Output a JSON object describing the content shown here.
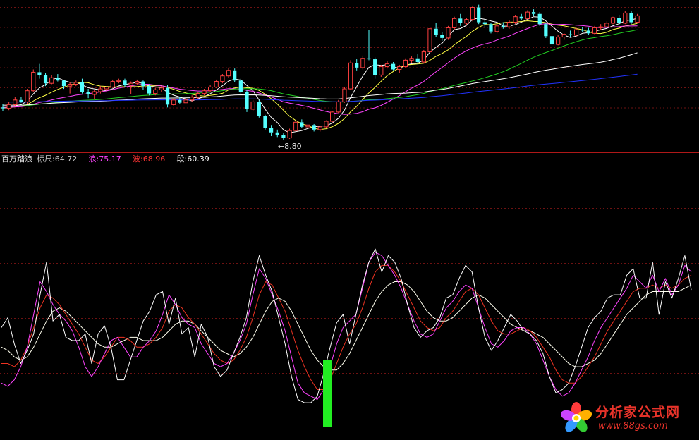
{
  "chart_data": [
    {
      "type": "candlestick",
      "panel": "price",
      "grid": true,
      "min_price_label": "←8.80",
      "ylim": [
        8.2,
        16.2
      ],
      "candles": [
        [
          10.55,
          10.75,
          10.35,
          10.5
        ],
        [
          10.5,
          10.85,
          10.4,
          10.7
        ],
        [
          10.7,
          11.1,
          10.6,
          10.95
        ],
        [
          10.95,
          11.1,
          10.8,
          10.85
        ],
        [
          10.85,
          11.55,
          10.75,
          11.45
        ],
        [
          11.45,
          12.6,
          11.4,
          12.45
        ],
        [
          12.45,
          12.9,
          12.1,
          12.3
        ],
        [
          12.3,
          12.4,
          11.7,
          11.85
        ],
        [
          11.85,
          12.3,
          11.8,
          12.15
        ],
        [
          12.15,
          12.35,
          11.95,
          12.0
        ],
        [
          12.0,
          12.05,
          11.55,
          11.7
        ],
        [
          11.7,
          11.9,
          11.3,
          11.8
        ],
        [
          11.8,
          12.0,
          11.7,
          11.9
        ],
        [
          11.9,
          12.1,
          11.3,
          11.4
        ],
        [
          11.4,
          11.55,
          11.05,
          11.25
        ],
        [
          11.25,
          11.5,
          11.0,
          11.4
        ],
        [
          11.4,
          11.7,
          11.3,
          11.55
        ],
        [
          11.55,
          11.7,
          11.45,
          11.65
        ],
        [
          11.65,
          12.05,
          11.6,
          11.95
        ],
        [
          11.95,
          12.1,
          11.85,
          12.0
        ],
        [
          12.0,
          12.1,
          11.65,
          11.75
        ],
        [
          11.75,
          11.95,
          11.25,
          11.85
        ],
        [
          11.85,
          12.05,
          11.75,
          11.95
        ],
        [
          11.95,
          12.0,
          11.5,
          11.7
        ],
        [
          11.7,
          11.8,
          11.2,
          11.3
        ],
        [
          11.3,
          11.6,
          11.2,
          11.5
        ],
        [
          11.5,
          11.7,
          11.4,
          11.6
        ],
        [
          11.6,
          11.75,
          10.55,
          10.7
        ],
        [
          10.7,
          11.05,
          10.6,
          10.95
        ],
        [
          10.95,
          11.1,
          10.75,
          10.8
        ],
        [
          10.8,
          11.0,
          10.65,
          10.95
        ],
        [
          10.95,
          11.2,
          10.85,
          11.1
        ],
        [
          11.1,
          11.4,
          11.0,
          11.3
        ],
        [
          11.3,
          11.55,
          11.2,
          11.45
        ],
        [
          11.45,
          11.75,
          11.4,
          11.65
        ],
        [
          11.65,
          12.05,
          11.6,
          11.95
        ],
        [
          11.95,
          12.35,
          11.85,
          12.25
        ],
        [
          12.25,
          12.7,
          12.15,
          12.55
        ],
        [
          12.55,
          12.65,
          11.9,
          12.0
        ],
        [
          12.0,
          12.1,
          11.3,
          11.4
        ],
        [
          11.4,
          11.5,
          10.3,
          10.45
        ],
        [
          10.45,
          10.95,
          10.35,
          10.85
        ],
        [
          10.85,
          10.95,
          10.0,
          10.1
        ],
        [
          10.1,
          10.15,
          9.35,
          9.45
        ],
        [
          9.45,
          9.6,
          9.0,
          9.2
        ],
        [
          9.2,
          9.35,
          8.95,
          9.05
        ],
        [
          9.05,
          9.15,
          8.8,
          8.9
        ],
        [
          8.9,
          9.4,
          8.85,
          9.3
        ],
        [
          9.3,
          9.8,
          9.25,
          9.75
        ],
        [
          9.75,
          9.9,
          9.45,
          9.5
        ],
        [
          9.5,
          9.7,
          9.3,
          9.6
        ],
        [
          9.6,
          9.65,
          9.25,
          9.35
        ],
        [
          9.35,
          9.55,
          9.25,
          9.5
        ],
        [
          9.5,
          9.85,
          9.45,
          9.8
        ],
        [
          9.8,
          10.35,
          9.75,
          10.3
        ],
        [
          10.3,
          10.95,
          10.25,
          10.85
        ],
        [
          10.85,
          11.65,
          10.8,
          11.55
        ],
        [
          11.55,
          13.1,
          11.5,
          12.95
        ],
        [
          12.95,
          13.15,
          12.55,
          12.7
        ],
        [
          12.7,
          13.35,
          12.6,
          13.2
        ],
        [
          13.2,
          14.75,
          13.1,
          13.15
        ],
        [
          13.15,
          13.25,
          12.1,
          12.3
        ],
        [
          12.3,
          12.85,
          12.2,
          12.75
        ],
        [
          12.75,
          13.05,
          12.65,
          12.9
        ],
        [
          12.9,
          13.0,
          12.55,
          12.6
        ],
        [
          12.6,
          12.85,
          12.4,
          12.75
        ],
        [
          12.75,
          13.2,
          12.7,
          13.1
        ],
        [
          13.1,
          13.3,
          12.95,
          13.2
        ],
        [
          13.2,
          13.45,
          12.9,
          13.0
        ],
        [
          13.0,
          13.65,
          12.95,
          13.55
        ],
        [
          13.55,
          14.95,
          13.45,
          14.8
        ],
        [
          14.8,
          15.1,
          14.35,
          14.45
        ],
        [
          14.45,
          14.6,
          14.15,
          14.3
        ],
        [
          14.3,
          14.95,
          14.2,
          14.85
        ],
        [
          14.85,
          15.45,
          14.75,
          15.35
        ],
        [
          15.35,
          15.6,
          14.95,
          15.1
        ],
        [
          15.1,
          15.4,
          15.0,
          15.3
        ],
        [
          15.3,
          16.05,
          15.2,
          15.95
        ],
        [
          15.95,
          16.1,
          15.05,
          15.15
        ],
        [
          15.15,
          15.3,
          14.85,
          15.05
        ],
        [
          15.05,
          15.1,
          14.55,
          14.65
        ],
        [
          14.65,
          15.05,
          14.55,
          14.95
        ],
        [
          14.95,
          15.15,
          14.8,
          14.9
        ],
        [
          14.9,
          15.25,
          14.8,
          15.15
        ],
        [
          15.15,
          15.55,
          15.05,
          15.45
        ],
        [
          15.45,
          15.6,
          15.25,
          15.35
        ],
        [
          15.35,
          15.8,
          15.3,
          15.7
        ],
        [
          15.7,
          15.85,
          15.5,
          15.6
        ],
        [
          15.6,
          15.7,
          14.95,
          15.05
        ],
        [
          15.05,
          15.1,
          14.3,
          14.4
        ],
        [
          14.4,
          14.45,
          13.85,
          13.95
        ],
        [
          13.95,
          14.45,
          13.9,
          14.35
        ],
        [
          14.35,
          14.55,
          14.2,
          14.5
        ],
        [
          14.5,
          14.7,
          14.35,
          14.45
        ],
        [
          14.45,
          14.85,
          14.4,
          14.75
        ],
        [
          14.75,
          14.9,
          14.6,
          14.7
        ],
        [
          14.7,
          14.85,
          14.45,
          14.55
        ],
        [
          14.55,
          14.95,
          14.5,
          14.85
        ],
        [
          14.85,
          15.05,
          14.75,
          14.9
        ],
        [
          14.9,
          15.2,
          14.85,
          15.1
        ],
        [
          15.1,
          15.45,
          15.05,
          15.4
        ],
        [
          15.4,
          15.55,
          15.0,
          15.1
        ],
        [
          15.1,
          15.75,
          15.05,
          15.65
        ],
        [
          15.65,
          15.75,
          15.05,
          15.15
        ],
        [
          15.15,
          15.6,
          15.1,
          15.5
        ]
      ],
      "lines": [
        {
          "color": "#ffffff",
          "kind": "ma",
          "period": 5
        },
        {
          "color": "#ffff44",
          "kind": "ma",
          "period": 10
        },
        {
          "color": "#ff44ff",
          "kind": "ma",
          "period": 20
        },
        {
          "color": "#22cc22",
          "kind": "ma",
          "period": 40
        },
        {
          "color": "#ffffff",
          "kind": "ma",
          "period": 60
        },
        {
          "color": "#2233ff",
          "kind": "ma",
          "period": 120
        }
      ],
      "pre_history_start": 11.2
    },
    {
      "type": "line",
      "panel": "indicator",
      "grid": true,
      "ylim": [
        0,
        110
      ],
      "legend": {
        "title": "百万踏浪",
        "items": [
          {
            "label": "标尺:",
            "value": "64.72",
            "label_color": "#c8c8c8",
            "value_color": "#c8c8c8"
          },
          {
            "label": "浪:",
            "value": "75.17",
            "label_color": "#ff44ff",
            "value_color": "#ff44ff"
          },
          {
            "label": "波:",
            "value": "68.96",
            "label_color": "#ff3333",
            "value_color": "#ff3333"
          },
          {
            "label": "段:",
            "value": "60.39",
            "label_color": "#ffffff",
            "value_color": "#ffffff"
          }
        ]
      },
      "series": [
        {
          "color": "#ffffff",
          "values": [
            52,
            58,
            42,
            30,
            38,
            48,
            72,
            92,
            56,
            60,
            46,
            44,
            44,
            48,
            30,
            48,
            53,
            40,
            20,
            20,
            32,
            44,
            56,
            62,
            72,
            74,
            54,
            70,
            48,
            52,
            34,
            54,
            46,
            28,
            22,
            26,
            36,
            46,
            58,
            80,
            96,
            84,
            74,
            58,
            42,
            22,
            8,
            6,
            6,
            10,
            24,
            40,
            55,
            60,
            42,
            60,
            78,
            92,
            100,
            86,
            96,
            92,
            82,
            66,
            52,
            46,
            50,
            52,
            58,
            70,
            72,
            82,
            90,
            86,
            64,
            46,
            38,
            44,
            52,
            60,
            56,
            50,
            48,
            44,
            36,
            22,
            12,
            14,
            18,
            28,
            40,
            52,
            58,
            62,
            70,
            72,
            72,
            84,
            88,
            70,
            70,
            92,
            60,
            80,
            70,
            82,
            96,
            75
          ]
        },
        {
          "color": "#ff44ff",
          "values": [
            18,
            16,
            20,
            28,
            40,
            60,
            80,
            74,
            66,
            60,
            56,
            50,
            40,
            28,
            22,
            28,
            36,
            44,
            46,
            40,
            34,
            34,
            40,
            44,
            50,
            60,
            72,
            66,
            58,
            54,
            52,
            42,
            36,
            30,
            28,
            30,
            36,
            44,
            54,
            72,
            88,
            82,
            72,
            62,
            50,
            34,
            18,
            12,
            10,
            8,
            14,
            28,
            42,
            52,
            56,
            60,
            76,
            92,
            98,
            96,
            90,
            84,
            76,
            66,
            56,
            48,
            46,
            48,
            56,
            64,
            68,
            74,
            78,
            76,
            64,
            52,
            42,
            40,
            44,
            50,
            52,
            52,
            48,
            42,
            32,
            22,
            14,
            10,
            12,
            18,
            26,
            34,
            44,
            52,
            58,
            64,
            70,
            76,
            84,
            80,
            76,
            84,
            74,
            82,
            72,
            78,
            90,
            86
          ]
        },
        {
          "color": "#ee3322",
          "values": [
            30,
            30,
            28,
            32,
            40,
            52,
            64,
            72,
            70,
            66,
            60,
            54,
            48,
            40,
            32,
            30,
            34,
            40,
            46,
            46,
            44,
            40,
            40,
            42,
            46,
            52,
            62,
            66,
            64,
            58,
            54,
            48,
            42,
            36,
            32,
            30,
            32,
            38,
            46,
            58,
            72,
            80,
            78,
            70,
            62,
            50,
            38,
            28,
            20,
            14,
            14,
            20,
            30,
            40,
            48,
            54,
            64,
            76,
            86,
            90,
            90,
            86,
            80,
            72,
            64,
            56,
            52,
            50,
            52,
            58,
            62,
            68,
            74,
            76,
            72,
            64,
            56,
            50,
            48,
            48,
            50,
            52,
            50,
            46,
            40,
            34,
            26,
            20,
            18,
            18,
            22,
            28,
            34,
            42,
            50,
            56,
            62,
            68,
            74,
            76,
            76,
            78,
            76,
            78,
            76,
            78,
            82,
            84
          ]
        },
        {
          "color": "#ffffee",
          "values": [
            40,
            38,
            34,
            32,
            34,
            40,
            48,
            56,
            62,
            64,
            62,
            58,
            54,
            50,
            46,
            42,
            40,
            40,
            42,
            44,
            46,
            46,
            44,
            44,
            44,
            46,
            50,
            54,
            56,
            56,
            54,
            50,
            46,
            42,
            38,
            36,
            34,
            36,
            40,
            46,
            54,
            62,
            68,
            70,
            68,
            62,
            54,
            46,
            38,
            32,
            28,
            26,
            26,
            30,
            36,
            44,
            52,
            60,
            68,
            74,
            78,
            80,
            80,
            78,
            74,
            68,
            62,
            58,
            56,
            56,
            58,
            62,
            66,
            70,
            72,
            70,
            66,
            62,
            58,
            54,
            52,
            50,
            50,
            48,
            46,
            42,
            38,
            34,
            30,
            28,
            28,
            30,
            32,
            36,
            42,
            48,
            54,
            60,
            64,
            68,
            72,
            74,
            74,
            74,
            74,
            74,
            76,
            78
          ]
        }
      ]
    }
  ],
  "watermark": {
    "name": "分析家公式网",
    "url": "www.88gs.com"
  }
}
